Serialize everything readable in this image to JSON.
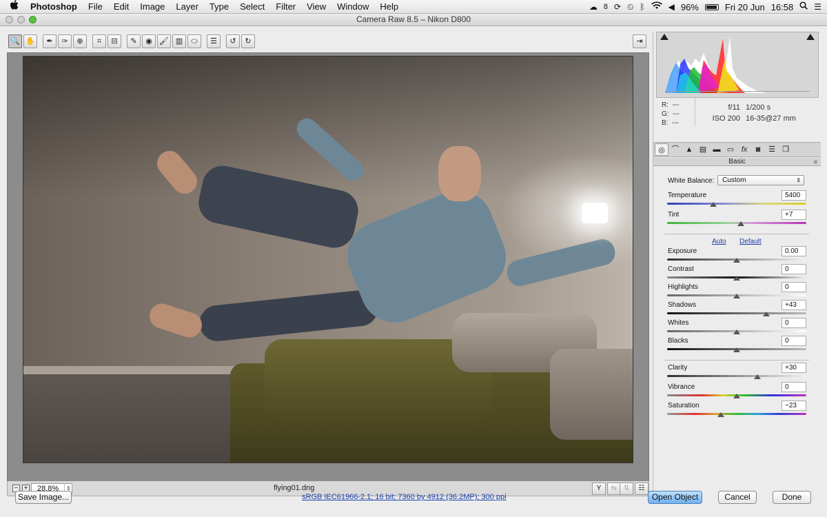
{
  "menubar": {
    "apple_icon": "",
    "app_name": "Photoshop",
    "items": [
      "File",
      "Edit",
      "Image",
      "Layer",
      "Type",
      "Select",
      "Filter",
      "View",
      "Window",
      "Help"
    ],
    "status": {
      "notification_count": "8",
      "battery": "96%",
      "date": "Fri 20 Jun",
      "time": "16:58"
    }
  },
  "window": {
    "title": "Camera Raw 8.5  –  Nikon D800"
  },
  "toolbar": {
    "tools": [
      "zoom-tool",
      "hand-tool",
      "white-balance-tool",
      "color-sampler-tool",
      "targeted-adjustment-tool",
      "crop-tool",
      "straighten-tool",
      "spot-removal-tool",
      "red-eye-removal-tool",
      "adjustment-brush-tool",
      "graduated-filter-tool",
      "radial-filter-tool",
      "preferences-button",
      "rotate-left-button",
      "rotate-right-button"
    ],
    "glyphs": [
      "🔍",
      "✋",
      "✒",
      "✑",
      "⊕",
      "⌗",
      "⊟",
      "✎",
      "◉",
      "🖌",
      "▥",
      "⬭",
      "☰",
      "↺",
      "↻"
    ]
  },
  "preview": {
    "zoom_value": "28.8%",
    "filename": "flying01.dng"
  },
  "histogram_info": {
    "r_label": "R:",
    "g_label": "G:",
    "b_label": "B:",
    "r_value": "---",
    "g_value": "---",
    "b_value": "---",
    "aperture": "f/11",
    "shutter": "1/200 s",
    "iso": "ISO 200",
    "lens": "16-35@27 mm"
  },
  "panel": {
    "section_title": "Basic",
    "white_balance_label": "White Balance:",
    "white_balance_value": "Custom",
    "auto_link": "Auto",
    "default_link": "Default",
    "sliders": {
      "temperature": {
        "label": "Temperature",
        "value": "5400",
        "pos": 0.33
      },
      "tint": {
        "label": "Tint",
        "value": "+7",
        "pos": 0.53
      },
      "exposure": {
        "label": "Exposure",
        "value": "0.00",
        "pos": 0.5
      },
      "contrast": {
        "label": "Contrast",
        "value": "0",
        "pos": 0.5
      },
      "highlights": {
        "label": "Highlights",
        "value": "0",
        "pos": 0.5
      },
      "shadows": {
        "label": "Shadows",
        "value": "+43",
        "pos": 0.715
      },
      "whites": {
        "label": "Whites",
        "value": "0",
        "pos": 0.5
      },
      "blacks": {
        "label": "Blacks",
        "value": "0",
        "pos": 0.5
      },
      "clarity": {
        "label": "Clarity",
        "value": "+30",
        "pos": 0.65
      },
      "vibrance": {
        "label": "Vibrance",
        "value": "0",
        "pos": 0.5
      },
      "saturation": {
        "label": "Saturation",
        "value": "−23",
        "pos": 0.385
      }
    }
  },
  "footer": {
    "save_image": "Save Image...",
    "workflow_options": "sRGB IEC61966-2.1; 16 bit; 7360 by 4912 (36.2MP); 300 ppi",
    "open_object": "Open Object",
    "cancel": "Cancel",
    "done": "Done"
  },
  "colors": {
    "accent": "#6fb1f0",
    "link": "#1b3fa8"
  }
}
